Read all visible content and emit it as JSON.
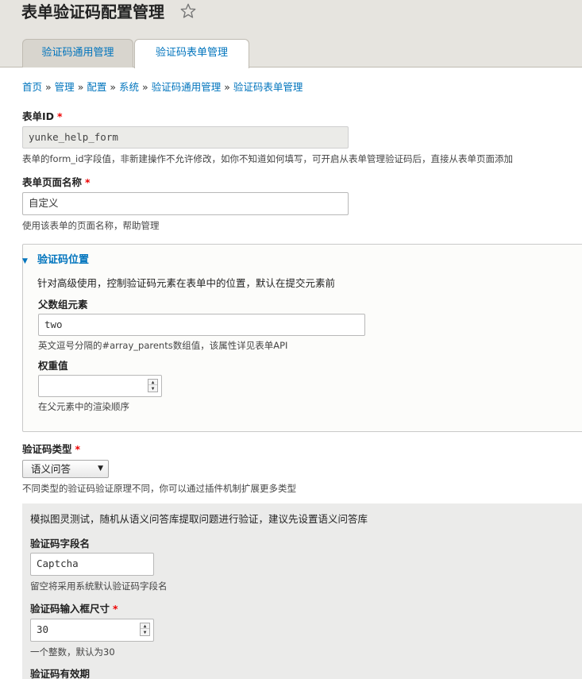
{
  "header": {
    "title": "表单验证码配置管理",
    "star_icon": "star-outline-icon",
    "tabs": [
      {
        "label": "验证码通用管理",
        "active": false
      },
      {
        "label": "验证码表单管理",
        "active": true
      }
    ]
  },
  "breadcrumb": [
    "首页",
    "管理",
    "配置",
    "系统",
    "验证码通用管理",
    "验证码表单管理"
  ],
  "breadcrumb_sep": "»",
  "form": {
    "form_id": {
      "label": "表单ID",
      "required_mark": "*",
      "value": "yunke_help_form",
      "description": "表单的form_id字段值，非新建操作不允许修改，如你不知道如何填写，可开启从表单管理验证码后，直接从表单页面添加"
    },
    "page_name": {
      "label": "表单页面名称",
      "required_mark": "*",
      "value": "自定义",
      "description": "使用该表单的页面名称，帮助管理"
    },
    "position_fieldset": {
      "legend": "验证码位置",
      "caret": "▼",
      "intro": "针对高级使用，控制验证码元素在表单中的位置，默认在提交元素前",
      "parents": {
        "label": "父数组元素",
        "value": "two",
        "description": "英文逗号分隔的#array_parents数组值，该属性详见表单API"
      },
      "weight": {
        "label": "权重值",
        "value": "",
        "description": "在父元素中的渲染顺序"
      }
    },
    "captcha_type": {
      "label": "验证码类型",
      "required_mark": "*",
      "selected": "语义问答",
      "arrow": "▼",
      "description": "不同类型的验证码验证原理不同，你可以通过插件机制扩展更多类型"
    },
    "type_settings": {
      "intro": "模拟图灵测试，随机从语义问答库提取问题进行验证，建议先设置语义问答库",
      "field_name": {
        "label": "验证码字段名",
        "value": "Captcha",
        "description": "留空将采用系统默认验证码字段名"
      },
      "input_size": {
        "label": "验证码输入框尺寸",
        "required_mark": "*",
        "value": "30",
        "description": "一个整数，默认为30"
      },
      "validity": {
        "label": "验证码有效期"
      }
    }
  },
  "spinner": {
    "up": "▲",
    "down": "▼"
  }
}
